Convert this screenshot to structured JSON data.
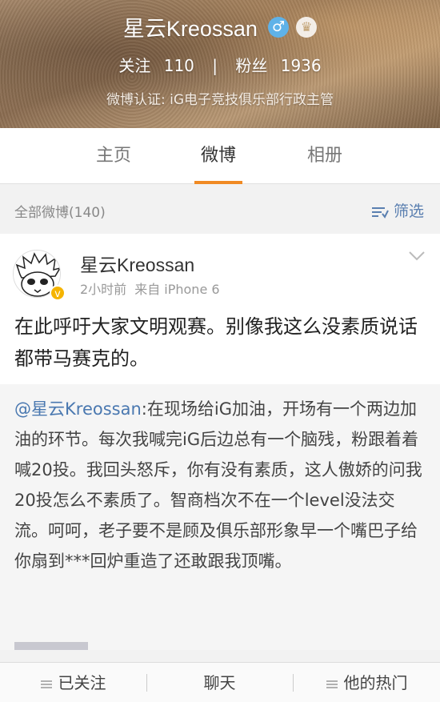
{
  "profile": {
    "username": "星云Kreossan",
    "gender_icon": "male-icon",
    "crown_icon": "crown-icon",
    "following_label": "关注",
    "following_count": "110",
    "followers_label": "粉丝",
    "followers_count": "1936",
    "verification": "微博认证: iG电子竞技俱乐部行政主管"
  },
  "tabs": [
    {
      "label": "主页",
      "active": false
    },
    {
      "label": "微博",
      "active": true
    },
    {
      "label": "相册",
      "active": false
    }
  ],
  "filter_bar": {
    "all_label": "全部微博(140)",
    "filter_label": "筛选"
  },
  "post": {
    "author": "星云Kreossan",
    "time": "2小时前",
    "source": "来自 iPhone 6",
    "text": "在此呼吁大家文明观赛。别像我这么没素质说话都带马赛克的。",
    "repost": {
      "mention": "@星云Kreossan",
      "text": ":在现场给iG加油，开场有一个两边加油的环节。每次我喊完iG后边总有一个脑残，粉跟着着喊20投。我回头怒斥，你有没有素质，这人傲娇的问我20投怎么不素质了。智商档次不在一个level没法交流。呵呵，老子要不是顾及俱乐部形象早一个嘴巴子给你扇到***回炉重造了还敢跟我顶嘴。"
    }
  },
  "bottom_bar": {
    "follow_label": "已关注",
    "chat_label": "聊天",
    "hot_label": "他的热门"
  },
  "colors": {
    "accent": "#f08a24",
    "link": "#4a78b0",
    "verified": "#f5b400"
  }
}
